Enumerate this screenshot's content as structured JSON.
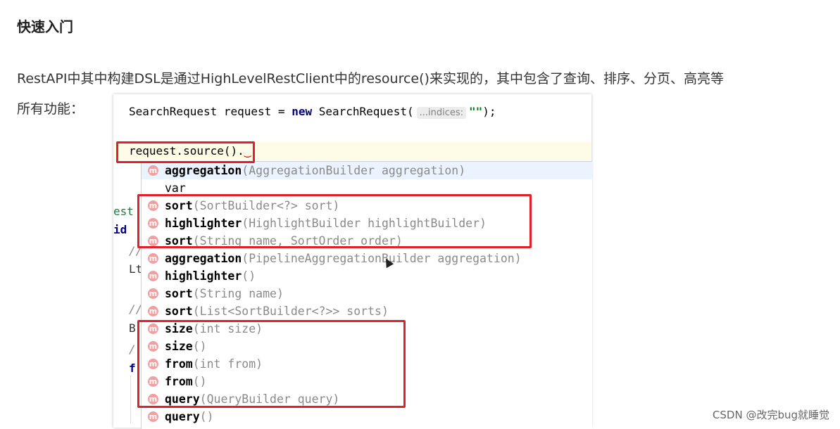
{
  "heading": "快速入门",
  "paragraph": {
    "line1": "RestAPI中其中构建DSL是通过HighLevelRestClient中的resource()来实现的，其中包含了查询、排序、分页、高亮等",
    "line2": "所有功能："
  },
  "editor": {
    "line1": {
      "pre": "SearchRequest request = ",
      "keyword": "new",
      "cls": " SearchRequest(",
      "hint": "...indices:",
      "string": "\"\"",
      "end": ");"
    },
    "line2": {
      "text": "request.source()",
      "dot": ".",
      "squiggle": "‿"
    },
    "background_fragments": [
      "est",
      "id",
      "//",
      "Lt",
      "//",
      "B",
      "/",
      "f"
    ]
  },
  "completion": {
    "icon_letter": "m",
    "items": [
      {
        "name": "aggregation",
        "params": "(AggregationBuilder aggregation)",
        "icon": true,
        "selected": true
      },
      {
        "name": "var",
        "params": "",
        "icon": false,
        "selected": false
      },
      {
        "name": "sort",
        "params": "(SortBuilder<?> sort)",
        "icon": true,
        "selected": false
      },
      {
        "name": "highlighter",
        "params": "(HighlightBuilder highlightBuilder)",
        "icon": true,
        "selected": false
      },
      {
        "name": "sort",
        "params": "(String name, SortOrder order)",
        "icon": true,
        "selected": false
      },
      {
        "name": "aggregation",
        "params": "(PipelineAggregationBuilder aggregation)",
        "icon": true,
        "selected": false
      },
      {
        "name": "highlighter",
        "params": "()",
        "icon": true,
        "selected": false
      },
      {
        "name": "sort",
        "params": "(String name)",
        "icon": true,
        "selected": false
      },
      {
        "name": "sort",
        "params": "(List<SortBuilder<?>> sorts)",
        "icon": true,
        "selected": false
      },
      {
        "name": "size",
        "params": "(int size)",
        "icon": true,
        "selected": false
      },
      {
        "name": "size",
        "params": "()",
        "icon": true,
        "selected": false
      },
      {
        "name": "from",
        "params": "(int from)",
        "icon": true,
        "selected": false
      },
      {
        "name": "from",
        "params": "()",
        "icon": true,
        "selected": false
      },
      {
        "name": "query",
        "params": "(QueryBuilder query)",
        "icon": true,
        "selected": false
      },
      {
        "name": "query",
        "params": "()",
        "icon": true,
        "selected": false
      }
    ]
  },
  "colors": {
    "highlight_box": "#e3202a",
    "method_icon": "#f0a0a0",
    "keyword": "#000080",
    "string": "#067d17"
  },
  "watermark": "CSDN @改完bug就睡觉"
}
